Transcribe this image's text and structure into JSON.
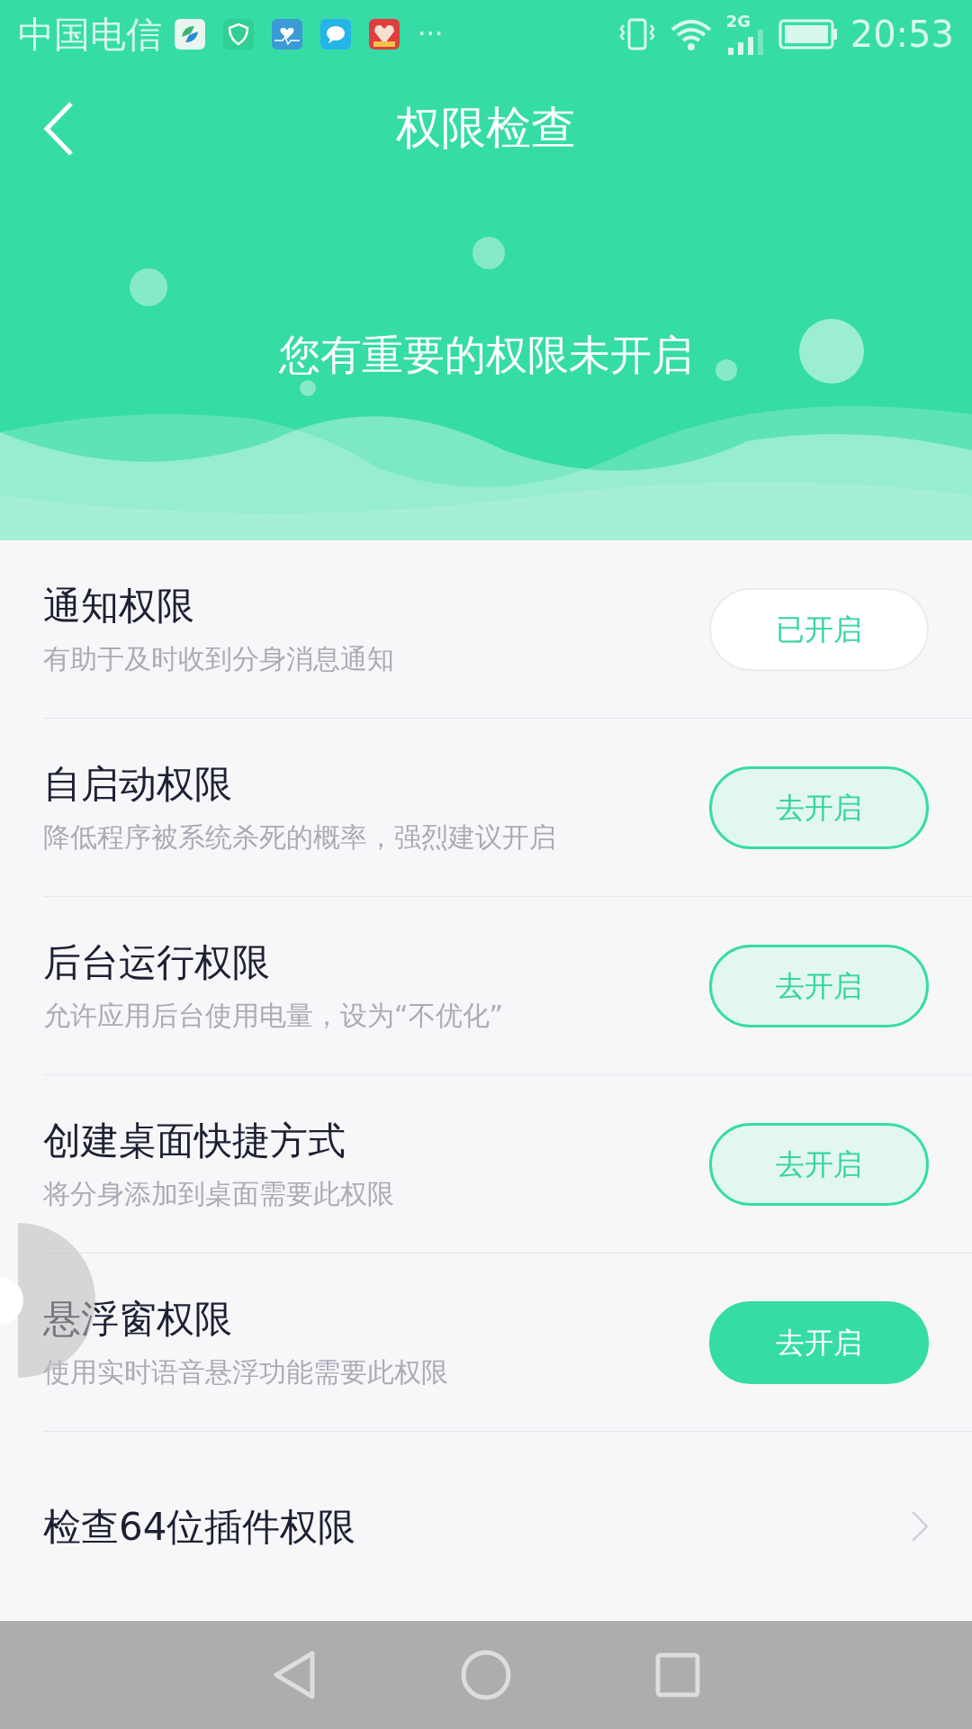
{
  "status_bar": {
    "carrier": "中国电信",
    "more": "···",
    "network": "2G",
    "time": "20:53"
  },
  "header": {
    "title": "权限检查"
  },
  "banner": {
    "message": "您有重要的权限未开启"
  },
  "permissions": [
    {
      "title": "通知权限",
      "description": "有助于及时收到分身消息通知",
      "button": {
        "label": "已开启",
        "kind": "done"
      }
    },
    {
      "title": "自启动权限",
      "description": "降低程序被系统杀死的概率，强烈建议开启",
      "button": {
        "label": "去开启",
        "kind": "outline"
      }
    },
    {
      "title": "后台运行权限",
      "description": "允许应用后台使用电量，设为“不优化”",
      "button": {
        "label": "去开启",
        "kind": "outline"
      }
    },
    {
      "title": "创建桌面快捷方式",
      "description": "将分身添加到桌面需要此权限",
      "button": {
        "label": "去开启",
        "kind": "outline"
      }
    },
    {
      "title": "悬浮窗权限",
      "description": "使用实时语音悬浮功能需要此权限",
      "button": {
        "label": "去开启",
        "kind": "filled"
      }
    }
  ],
  "link_row": {
    "title": "检查64位插件权限"
  }
}
